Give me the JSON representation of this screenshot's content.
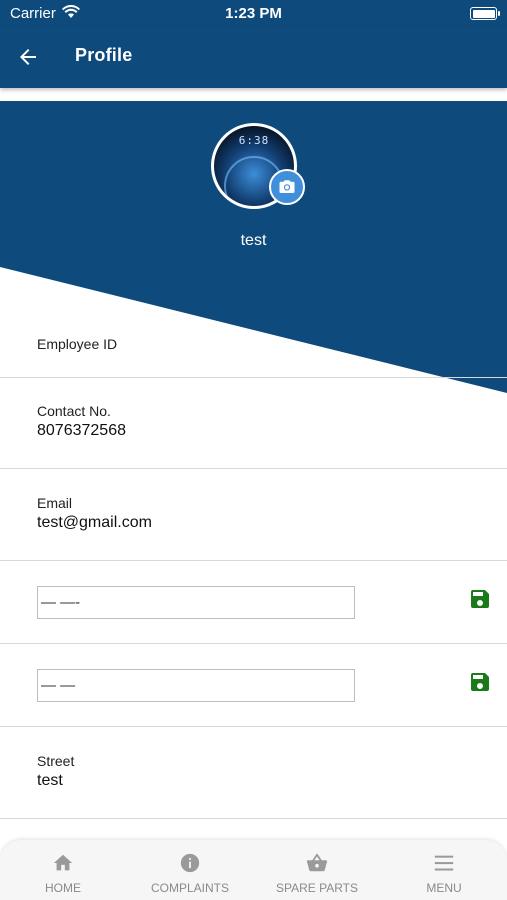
{
  "status_bar": {
    "carrier": "Carrier",
    "time": "1:23 PM"
  },
  "app_bar": {
    "title": "Profile"
  },
  "profile": {
    "name": "test",
    "avatar_clock": "6:38"
  },
  "fields": {
    "employee_id": {
      "label": "Employee ID",
      "value": ""
    },
    "contact": {
      "label": "Contact No.",
      "value": "8076372568"
    },
    "email": {
      "label": "Email",
      "value": "test@gmail.com"
    },
    "edit1": {
      "value": "— —-"
    },
    "edit2": {
      "value": "— —"
    },
    "street": {
      "label": "Street",
      "value": "test"
    }
  },
  "bottom_nav": {
    "home": "HOME",
    "complaints": "COMPLAINTS",
    "spare_parts": "SPARE PARTS",
    "menu": "MENU"
  },
  "colors": {
    "primary": "#0f4a7c",
    "accent": "#3f8fdb",
    "save": "#1a7a1a",
    "nav_inactive": "#8a8a8a"
  }
}
